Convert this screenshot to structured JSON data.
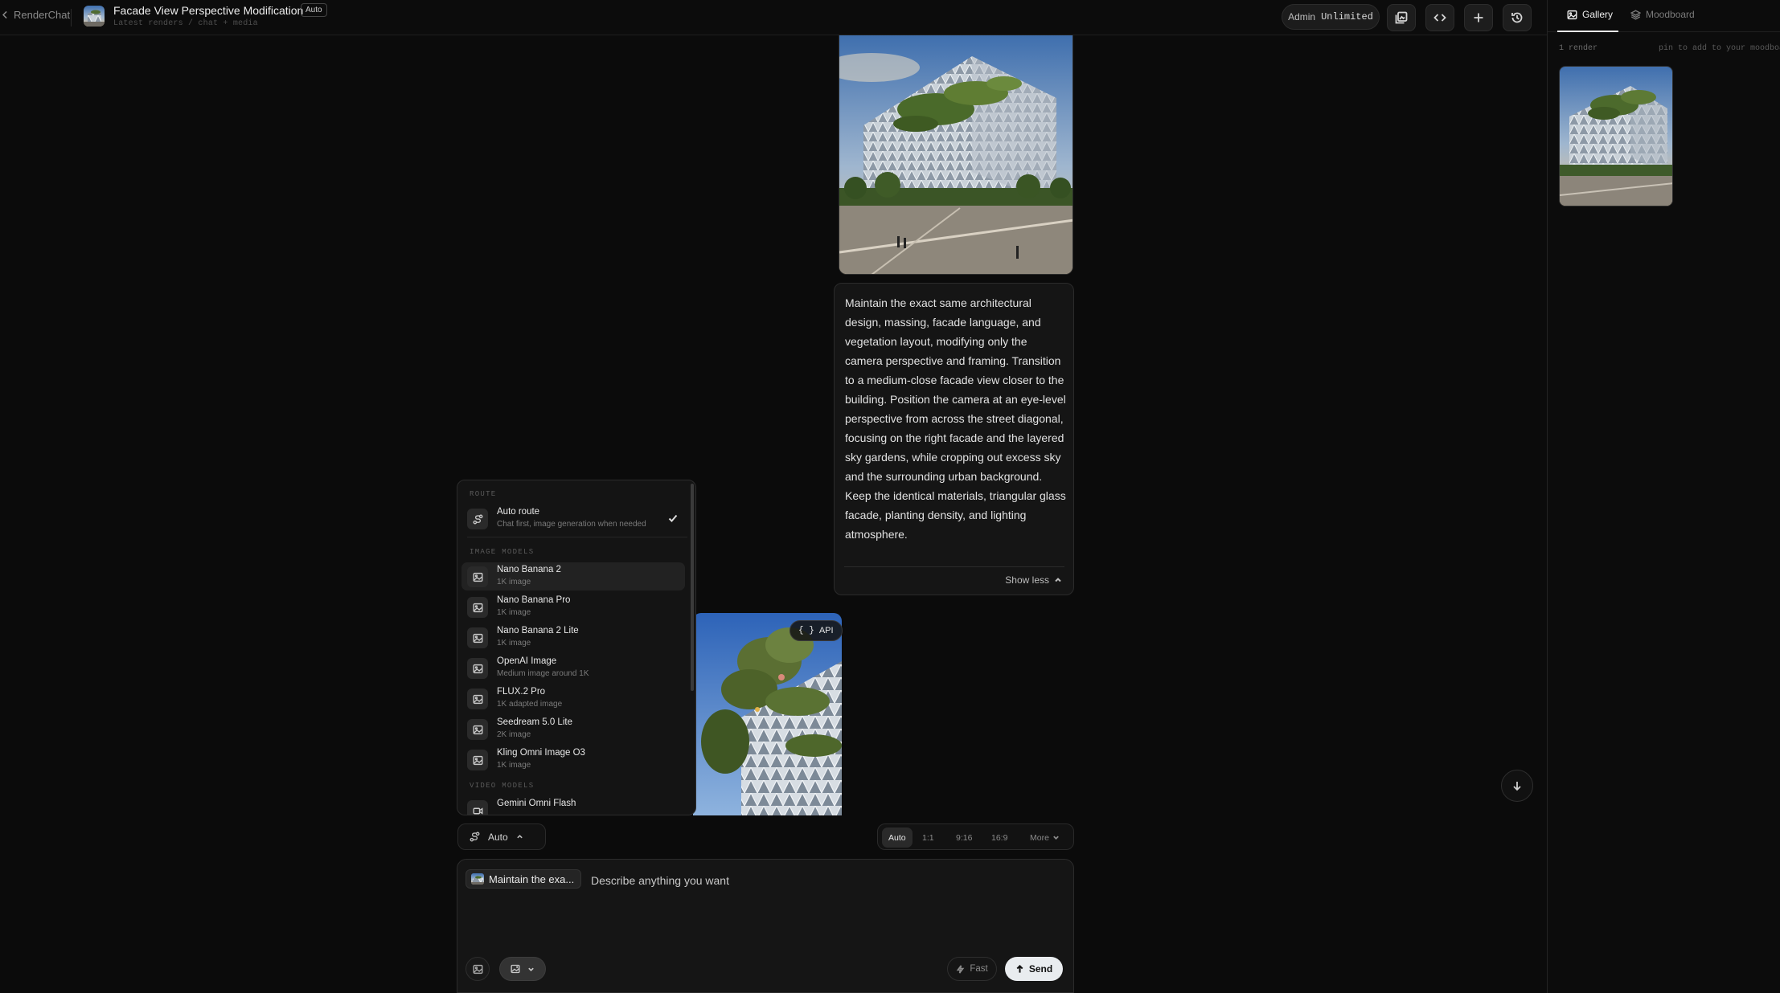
{
  "app": {
    "back_label": "RenderChat",
    "doc_title": "Facade View Perspective Modification",
    "doc_badge": "Auto",
    "doc_subtitle": "Latest renders / chat + media"
  },
  "account": {
    "role": "Admin",
    "plan": "Unlimited"
  },
  "toolbar_icons": [
    "copy-image-icon",
    "code-icon",
    "plus-icon",
    "history-icon"
  ],
  "right_panel": {
    "tabs": [
      {
        "label": "Gallery",
        "icon": "image-icon",
        "active": true
      },
      {
        "label": "Moodboard",
        "icon": "layers-icon",
        "active": false
      }
    ],
    "render_count": "1 render",
    "pin_hint": "pin to add to your moodboard"
  },
  "chat": {
    "prompt": "Maintain the exact same architectural design, massing, facade language, and vegetation layout, modifying only the camera perspective and framing. Transition to a medium-close facade view closer to the building. Position the camera at an eye-level perspective from across the street diagonal, focusing on the right facade and the layered sky gardens, while cropping out excess sky and the surrounding urban background. Keep the identical materials, triangular glass facade, planting density, and lighting atmosphere.",
    "show_less": "Show less",
    "api_badge": "API"
  },
  "model_menu": {
    "route_section": "ROUTE",
    "route": {
      "name": "Auto route",
      "desc": "Chat first, image generation when needed",
      "selected": true
    },
    "image_section": "IMAGE MODELS",
    "image_models": [
      {
        "name": "Nano Banana 2",
        "desc": "1K image",
        "highlighted": true
      },
      {
        "name": "Nano Banana Pro",
        "desc": "1K image"
      },
      {
        "name": "Nano Banana 2 Lite",
        "desc": "1K image"
      },
      {
        "name": "OpenAI Image",
        "desc": "Medium image around 1K"
      },
      {
        "name": "FLUX.2 Pro",
        "desc": "1K adapted image"
      },
      {
        "name": "Seedream 5.0 Lite",
        "desc": "2K image"
      },
      {
        "name": "Kling Omni Image O3",
        "desc": "1K image"
      }
    ],
    "video_section": "VIDEO MODELS",
    "video_models": [
      {
        "name": "Gemini Omni Flash",
        "desc": ""
      }
    ]
  },
  "controls": {
    "route_label": "Auto",
    "aspect_options": [
      {
        "label": "Auto",
        "active": true
      },
      {
        "label": "1:1",
        "active": false
      },
      {
        "label": "9:16",
        "active": false
      },
      {
        "label": "16:9",
        "active": false
      }
    ],
    "more_label": "More"
  },
  "composer": {
    "reference_chip": "Maintain the exa...",
    "placeholder": "Describe anything you want",
    "fast_label": "Fast",
    "send_label": "Send"
  }
}
